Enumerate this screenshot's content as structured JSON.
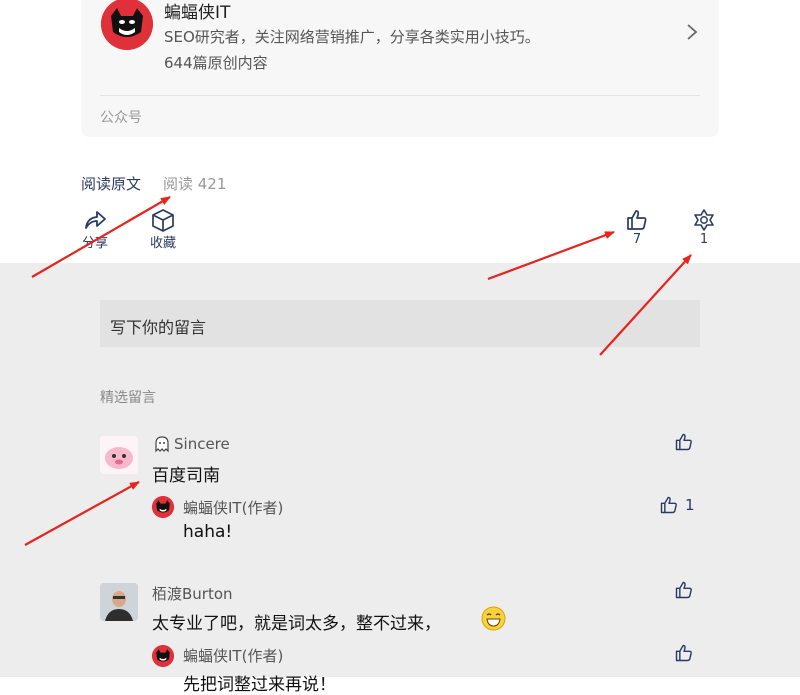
{
  "account": {
    "name": "蝙蝠侠IT",
    "description": "SEO研究者，关注网络营销推广，分享各类实用小技巧。",
    "article_count": "644篇原创内容",
    "type": "公众号"
  },
  "reading": {
    "original_link": "阅读原文",
    "read_count": "阅读 421"
  },
  "actions": {
    "share": "分享",
    "collect": "收藏",
    "like_count": "7",
    "wow_count": "1"
  },
  "comment_input": {
    "placeholder": "写下你的留言"
  },
  "comments_title": "精选留言",
  "comments": [
    {
      "author": "Sincere",
      "text": "百度司南",
      "reply": {
        "author": "蝙蝠侠IT(作者)",
        "text": "haha!",
        "likes": "1"
      }
    },
    {
      "author": "栢渡Burton",
      "text": "太专业了吧，就是词太多，整不过来，",
      "reply": {
        "author": "蝙蝠侠IT(作者)",
        "text": "先把词整过来再说！"
      }
    }
  ],
  "colors": {
    "accent": "#2b3a63",
    "annotation_arrow": "#e8231c",
    "bottom_bg": "#ededed"
  }
}
